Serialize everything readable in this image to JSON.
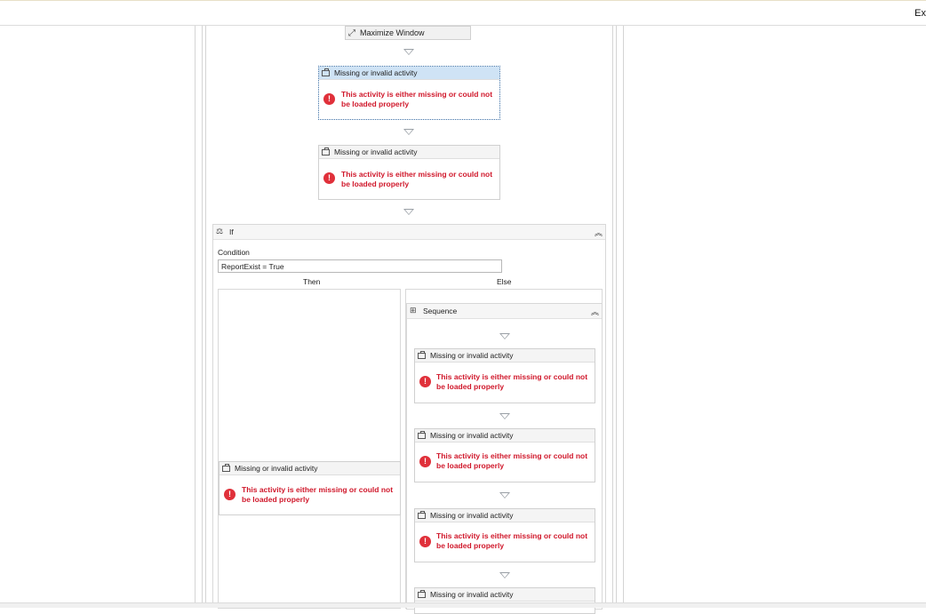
{
  "toolbar": {
    "right_text": "Ex"
  },
  "maximize": {
    "label": "Maximize Window",
    "icon": "maximize-icon"
  },
  "missing_title": "Missing or invalid activity",
  "missing_error": "This activity is either missing or could not be loaded properly",
  "if_block": {
    "title": "If",
    "condition_label": "Condition",
    "condition_value": "ReportExist = True",
    "then_label": "Then",
    "else_label": "Else"
  },
  "sequence": {
    "title": "Sequence"
  },
  "colors": {
    "error": "#d0182b",
    "error_icon": "#e0303a",
    "selected_header": "#cfe3f5"
  }
}
